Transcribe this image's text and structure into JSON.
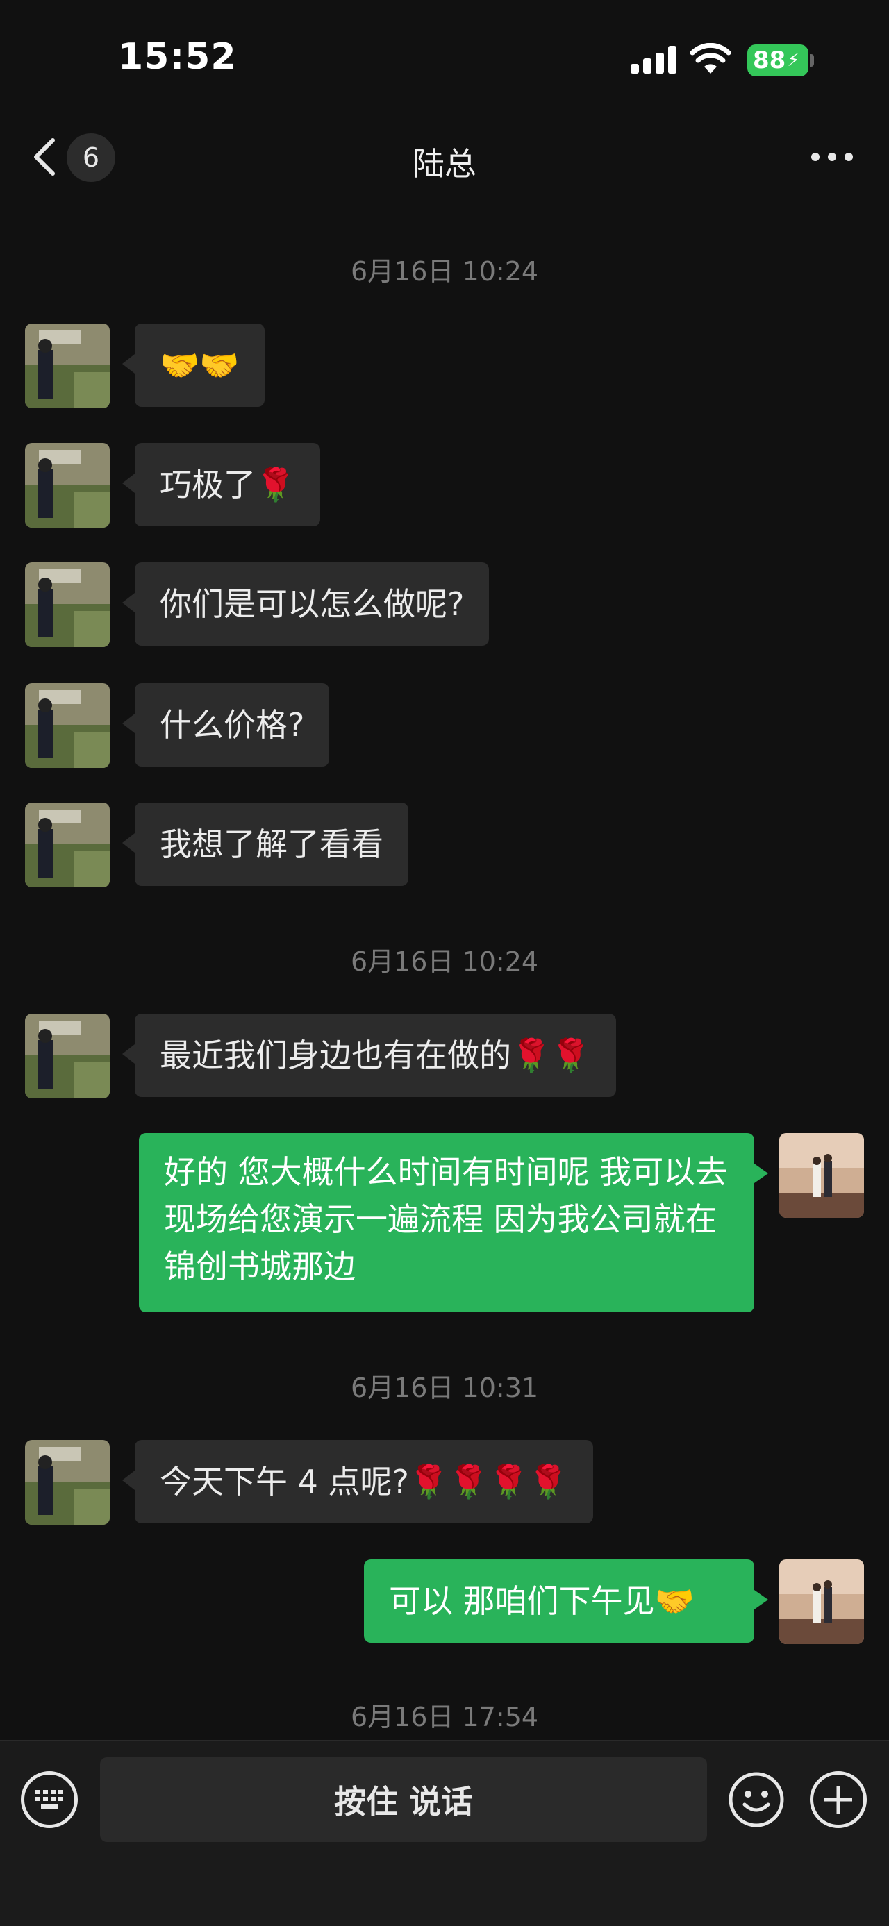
{
  "status": {
    "time": "15:52",
    "battery": "88"
  },
  "nav": {
    "unread_count": "6",
    "title": "陆总"
  },
  "messages": {
    "ts1": "6月16日 10:24",
    "m1": "🤝🤝",
    "m2": "巧极了🌹",
    "m3": "你们是可以怎么做呢?",
    "m4": "什么价格?",
    "m5": "我想了解了看看",
    "ts2": "6月16日 10:24",
    "m6": "最近我们身边也有在做的🌹🌹",
    "m7": "好的 您大概什么时间有时间呢 我可以去现场给您演示一遍流程 因为我公司就在锦创书城那边",
    "ts3": "6月16日 10:31",
    "m8": "今天下午 4 点呢?🌹🌹🌹🌹",
    "m9": "可以  那咱们下午见🤝",
    "ts4": "6月16日 17:54"
  },
  "input_bar": {
    "voice_label": "按住 说话"
  },
  "icons": {
    "back": "chevron-left-icon",
    "more": "more-dots-icon",
    "keyboard": "keyboard-icon",
    "emoji": "smiley-icon",
    "plus": "plus-circle-icon"
  },
  "colors": {
    "outgoing_bubble": "#29b35a",
    "incoming_bubble": "#2c2c2c",
    "background": "#111111"
  }
}
